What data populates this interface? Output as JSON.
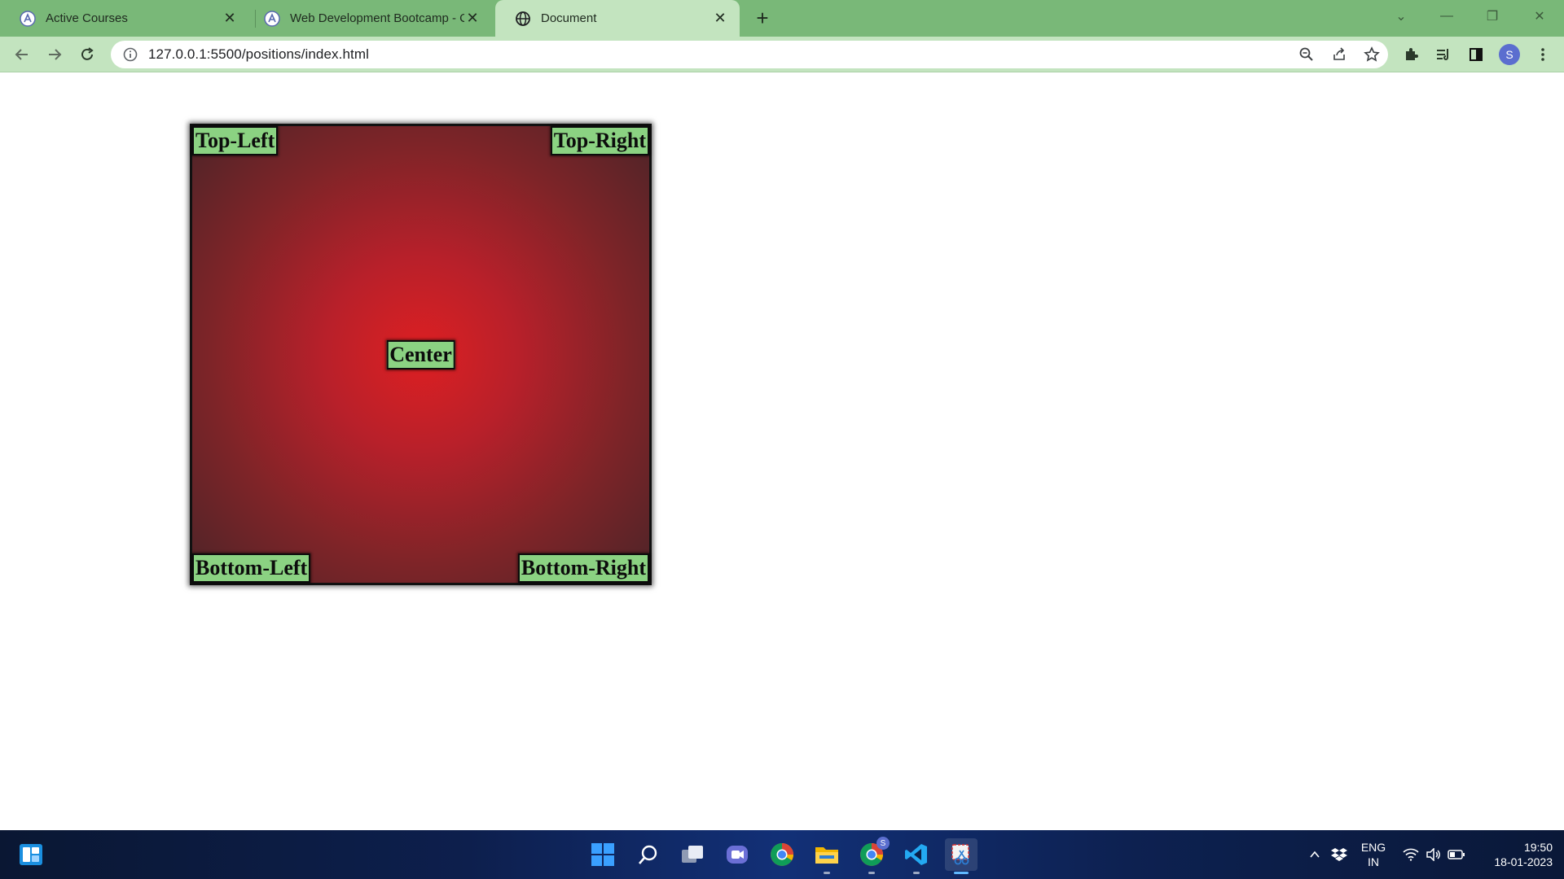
{
  "browser": {
    "tabs": [
      {
        "title": "Active Courses",
        "icon": "course-site-icon",
        "active": false
      },
      {
        "title": "Web Development Bootcamp - C",
        "icon": "course-site-icon",
        "active": false
      },
      {
        "title": "Document",
        "icon": "globe-icon",
        "active": true
      }
    ],
    "url": "127.0.0.1:5500/positions/index.html",
    "profile_initial": "S"
  },
  "page": {
    "box_colors": {
      "center": "#dd1f22",
      "edge": "#4c2428",
      "label_bg": "#8bd282"
    },
    "labels": {
      "top_left": "Top-Left",
      "top_right": "Top-Right",
      "center": "Center",
      "bottom_left": "Bottom-Left",
      "bottom_right": "Bottom-Right"
    }
  },
  "taskbar": {
    "language": "ENG",
    "region": "IN",
    "time": "19:50",
    "date": "18-01-2023",
    "chrome_badge": "S"
  }
}
